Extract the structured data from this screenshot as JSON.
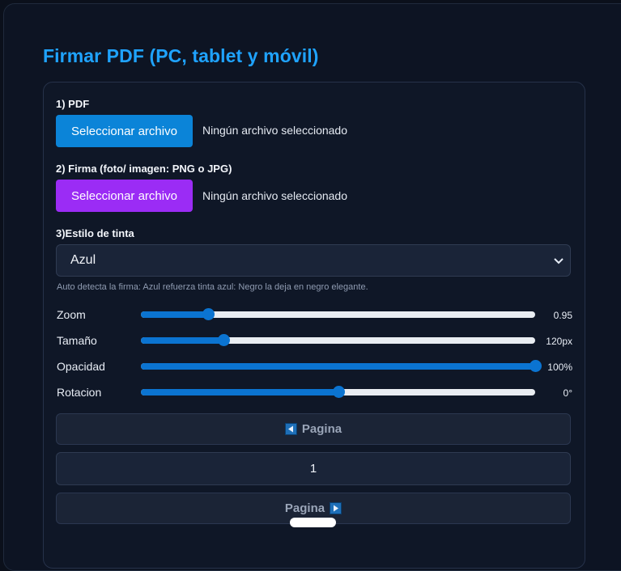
{
  "title": "Firmar PDF (PC, tablet y móvil)",
  "pdf": {
    "label": "1) PDF",
    "button": "Seleccionar archivo",
    "status": "Ningún archivo seleccionado"
  },
  "firma": {
    "label": "2) Firma (foto/ imagen: PNG o JPG)",
    "button": "Seleccionar archivo",
    "status": "Ningún archivo seleccionado"
  },
  "estilo": {
    "label": "3)Estilo de tinta",
    "selected": "Azul",
    "hint": "Auto detecta la firma: Azul refuerza tinta azul: Negro la deja en negro elegante."
  },
  "sliders": [
    {
      "label": "Zoom",
      "value": "0.95",
      "fraction": 0.17
    },
    {
      "label": "Tamaño",
      "value": "120px",
      "fraction": 0.21
    },
    {
      "label": "Opacidad",
      "value": "100%",
      "fraction": 1.0
    },
    {
      "label": "Rotacion",
      "value": "0°",
      "fraction": 0.5
    }
  ],
  "pagination": {
    "prev_label": "Pagina",
    "page_number": "1",
    "next_label": "Pagina"
  },
  "colors": {
    "accent": "#1fa3ff",
    "button_blue": "#0b84d8",
    "button_purple": "#9b2cf5",
    "slider": "#0b74d1"
  },
  "icons": {
    "prev": "arrow-left-icon",
    "next": "arrow-right-icon",
    "select": "chevron-down-icon"
  }
}
